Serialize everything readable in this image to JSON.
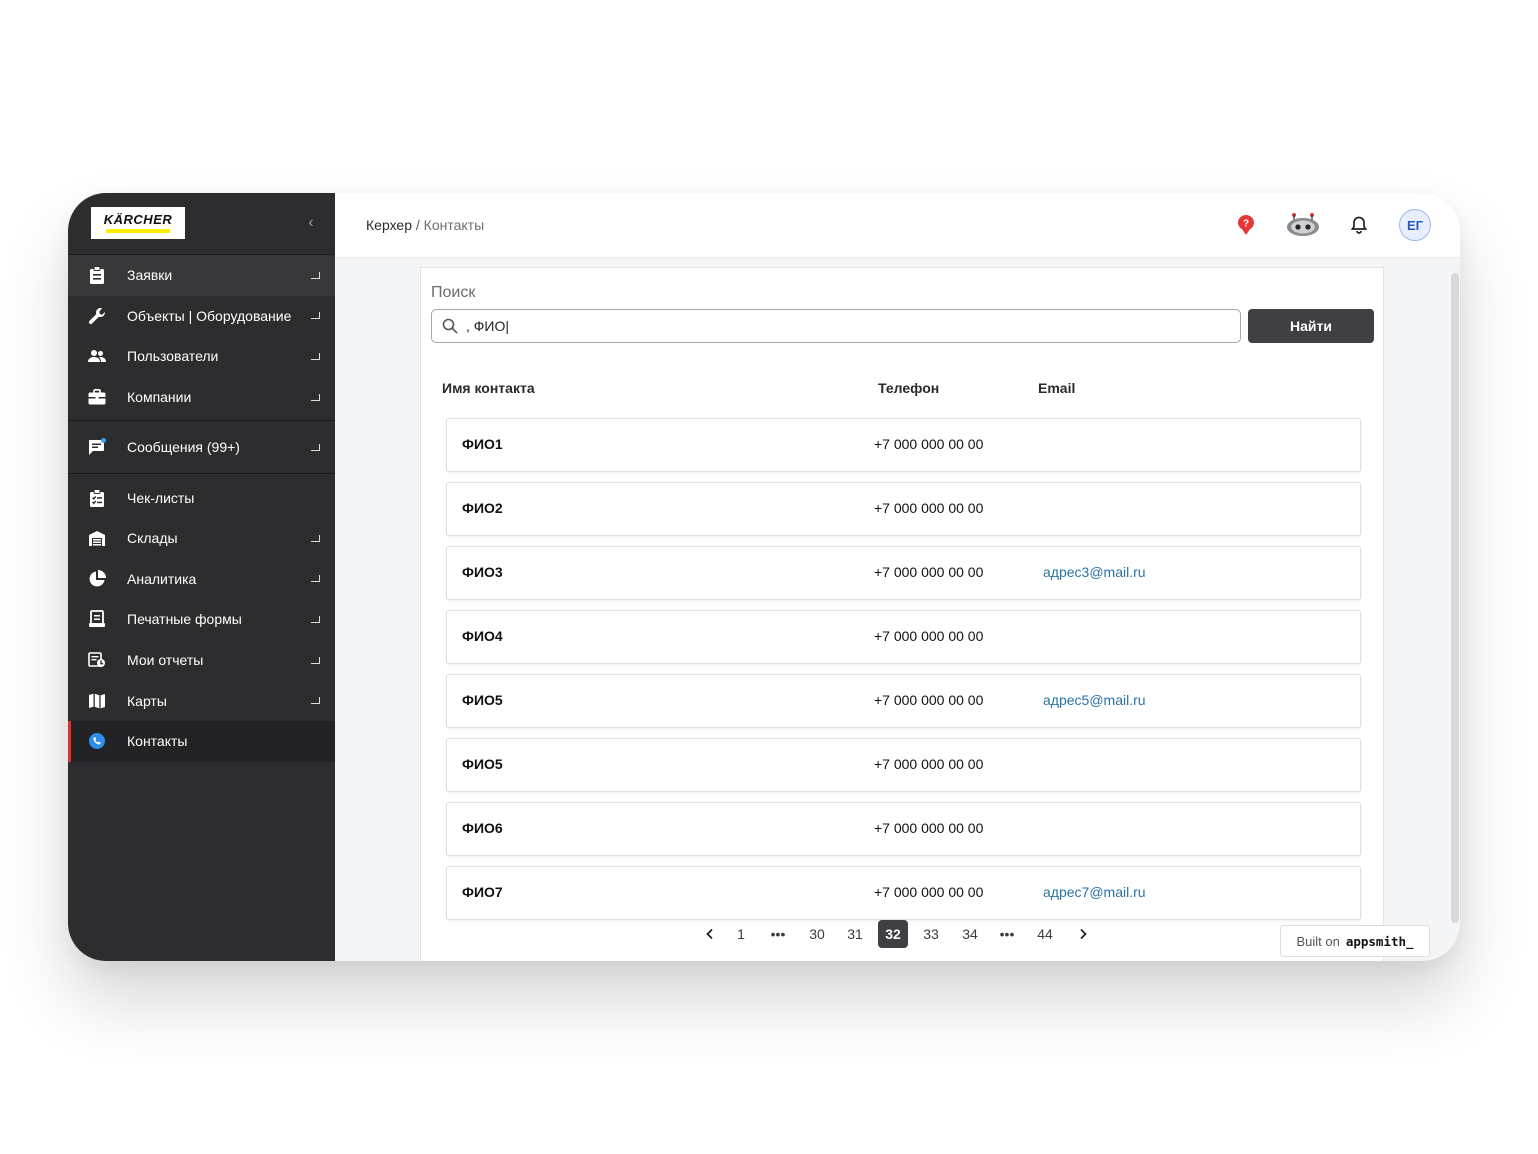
{
  "sidebar": {
    "logo_text": "KÄRCHER",
    "items": [
      {
        "label": "Заявки",
        "icon": "clipboard-icon"
      },
      {
        "label": "Объекты | Оборудование",
        "icon": "wrench-icon"
      },
      {
        "label": "Пользователи",
        "icon": "users-icon"
      },
      {
        "label": "Компании",
        "icon": "briefcase-icon"
      }
    ],
    "messages": {
      "label": "Сообщения (99+)",
      "icon": "chat-icon"
    },
    "items2": [
      {
        "label": "Чек-листы",
        "icon": "checklist-icon"
      },
      {
        "label": "Склады",
        "icon": "warehouse-icon"
      },
      {
        "label": "Аналитика",
        "icon": "pie-chart-icon"
      },
      {
        "label": "Печатные формы",
        "icon": "print-form-icon"
      },
      {
        "label": "Мои отчеты",
        "icon": "report-icon"
      },
      {
        "label": "Карты",
        "icon": "map-icon"
      },
      {
        "label": "Контакты",
        "icon": "phone-icon"
      }
    ]
  },
  "header": {
    "crumb_root": "Керхер",
    "crumb_sep": " / ",
    "crumb_current": "Контакты",
    "avatar_initials": "ЕГ"
  },
  "search": {
    "label": "Поиск",
    "value": ", ФИО|",
    "button": "Найти"
  },
  "table": {
    "columns": [
      "Имя контакта",
      "Телефон",
      "Email"
    ],
    "rows": [
      {
        "name": "ФИО1",
        "phone": "+7 000 000 00 00",
        "email": ""
      },
      {
        "name": "ФИО2",
        "phone": "+7 000 000 00 00",
        "email": ""
      },
      {
        "name": "ФИО3",
        "phone": "+7 000 000 00 00",
        "email": "адрес3@mail.ru"
      },
      {
        "name": "ФИО4",
        "phone": "+7 000 000 00 00",
        "email": ""
      },
      {
        "name": "ФИО5",
        "phone": "+7 000 000 00 00",
        "email": "адрес5@mail.ru"
      },
      {
        "name": "ФИО5",
        "phone": "+7 000 000 00 00",
        "email": ""
      },
      {
        "name": "ФИО6",
        "phone": "+7 000 000 00 00",
        "email": ""
      },
      {
        "name": "ФИО7",
        "phone": "+7 000 000 00 00",
        "email": "адрес7@mail.ru"
      }
    ]
  },
  "pagination": {
    "pages": [
      "1",
      "•••",
      "30",
      "31",
      "32",
      "33",
      "34",
      "•••",
      "44"
    ],
    "current": "32"
  },
  "built_on": {
    "prefix": "Built on",
    "brand": "appsmith_"
  },
  "colors": {
    "sidebar": "#2d2d2f",
    "accent": "#e0302f",
    "link": "#2a72a6",
    "button": "#3f3f44"
  }
}
